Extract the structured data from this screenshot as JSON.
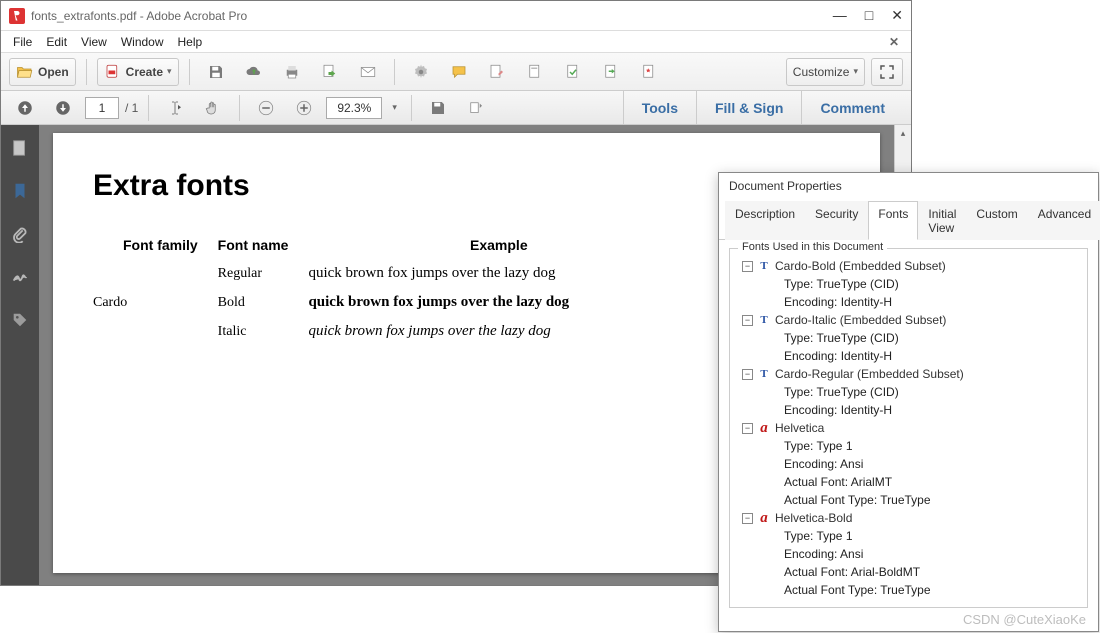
{
  "window": {
    "title": "fonts_extrafonts.pdf - Adobe Acrobat Pro"
  },
  "menubar": [
    "File",
    "Edit",
    "View",
    "Window",
    "Help"
  ],
  "toolbar1": {
    "open": "Open",
    "create": "Create",
    "customize": "Customize"
  },
  "toolbar2": {
    "page_current": "1",
    "page_total": "/ 1",
    "zoom": "92.3%",
    "tabs": {
      "tools": "Tools",
      "fillsign": "Fill & Sign",
      "comment": "Comment"
    }
  },
  "doc": {
    "heading": "Extra fonts",
    "headers": {
      "family": "Font family",
      "name": "Font name",
      "example": "Example"
    },
    "family": "Cardo",
    "rows": [
      {
        "name": "Regular",
        "example": "quick brown fox jumps over the lazy dog",
        "style": ""
      },
      {
        "name": "Bold",
        "example": "quick brown fox jumps over the lazy dog",
        "style": "bold"
      },
      {
        "name": "Italic",
        "example": "quick brown fox jumps over the lazy dog",
        "style": "italic"
      }
    ]
  },
  "dialog": {
    "title": "Document Properties",
    "tabs": [
      "Description",
      "Security",
      "Fonts",
      "Initial View",
      "Custom",
      "Advanced"
    ],
    "active_tab": 2,
    "legend": "Fonts Used in this Document",
    "fonts": [
      {
        "name": "Cardo-Bold (Embedded Subset)",
        "kind": "T",
        "lines": [
          "Type: TrueType (CID)",
          "Encoding: Identity-H"
        ]
      },
      {
        "name": "Cardo-Italic (Embedded Subset)",
        "kind": "T",
        "lines": [
          "Type: TrueType (CID)",
          "Encoding: Identity-H"
        ]
      },
      {
        "name": "Cardo-Regular (Embedded Subset)",
        "kind": "T",
        "lines": [
          "Type: TrueType (CID)",
          "Encoding: Identity-H"
        ]
      },
      {
        "name": "Helvetica",
        "kind": "A",
        "lines": [
          "Type: Type 1",
          "Encoding: Ansi",
          "Actual Font: ArialMT",
          "Actual Font Type: TrueType"
        ]
      },
      {
        "name": "Helvetica-Bold",
        "kind": "A",
        "lines": [
          "Type: Type 1",
          "Encoding: Ansi",
          "Actual Font: Arial-BoldMT",
          "Actual Font Type: TrueType"
        ]
      }
    ]
  },
  "watermark": "CSDN @CuteXiaoKe"
}
